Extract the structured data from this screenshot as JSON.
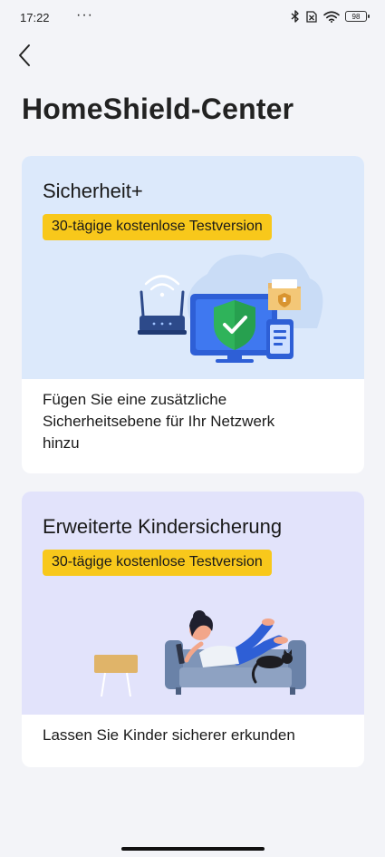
{
  "status_bar": {
    "time": "17:22",
    "more": "···",
    "battery": "98"
  },
  "header": {
    "back_icon": "chevron-left-icon",
    "title": "HomeShield-Center"
  },
  "cards": [
    {
      "title": "Sicherheit+",
      "badge": "30-tägige kostenlose Testversion",
      "description": "Fügen Sie eine zusätzliche\nSicherheitsebene für Ihr Netzwerk\nhinzu",
      "illustration": "security-network-illustration"
    },
    {
      "title": "Erweiterte Kindersicherung",
      "badge": "30-tägige kostenlose Testversion",
      "description": "Lassen Sie Kinder sicherer erkunden",
      "illustration": "child-on-sofa-illustration"
    }
  ],
  "colors": {
    "background": "#f3f4f8",
    "card1_top": "#dce9fb",
    "card2_top": "#e2e3fb",
    "badge": "#f8c81b",
    "shield_green": "#2fb35a"
  }
}
